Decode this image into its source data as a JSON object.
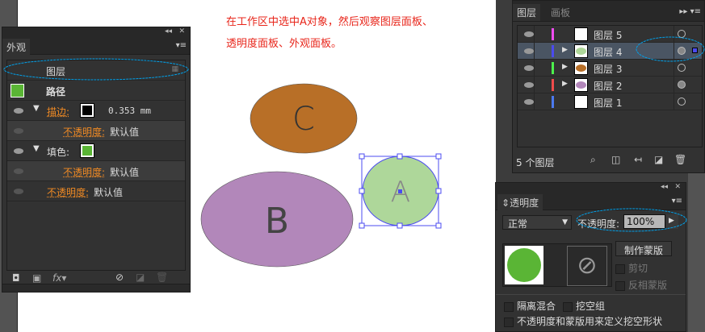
{
  "instruction": {
    "line1": "在工作区中选中A对象，然后观察图层面板、",
    "line2": "透明度面板、外观面板。"
  },
  "appearance": {
    "tab": "外观",
    "target": "图层",
    "object_type": "路径",
    "stroke_label": "描边:",
    "stroke_value": "0.353 mm",
    "opacity_label": "不透明度:",
    "opacity_value": "默认值",
    "fill_label": "填色:",
    "fx": "fx"
  },
  "canvas": {
    "objects": [
      {
        "label": "C",
        "color": "#b86f27"
      },
      {
        "label": "B",
        "color": "#b287ba"
      },
      {
        "label": "A",
        "color": "#aed79a",
        "selected": true
      }
    ]
  },
  "layers": {
    "tabs": [
      "图层",
      "画板"
    ],
    "items": [
      {
        "name": "图层 5",
        "color": "#f04cf0",
        "selected": false
      },
      {
        "name": "图层 4",
        "color": "#4b4bf0",
        "selected": true
      },
      {
        "name": "图层 3",
        "color": "#4cf04c",
        "selected": false
      },
      {
        "name": "图层 2",
        "color": "#f04b4b",
        "selected": false
      },
      {
        "name": "图层 1",
        "color": "#4b7af0",
        "selected": false
      }
    ],
    "count": "5 个图层"
  },
  "transparency": {
    "tab": "透明度",
    "blend_mode": "正常",
    "opacity_label": "不透明度:",
    "opacity_value": "100%",
    "make_mask": "制作蒙版",
    "clip": "剪切",
    "invert_mask": "反相蒙版",
    "isolate_blend": "隔离混合",
    "knockout_group": "挖空组",
    "opacity_mask_knockout": "不透明度和蒙版用来定义挖空形状"
  },
  "colors": {
    "annotation": "#00a0e9",
    "fill_green": "#5ab535",
    "selection": "#4b4bf0"
  }
}
